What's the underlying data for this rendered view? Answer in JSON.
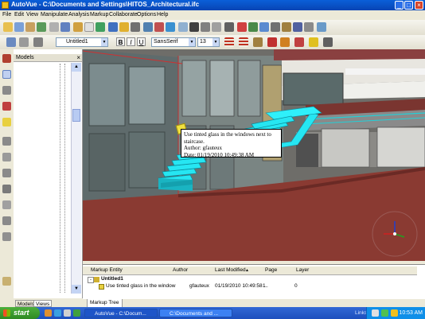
{
  "window": {
    "title": "AutoVue - C:\\Documents and Settings\\HITOS_Architectural.ifc"
  },
  "menu": [
    "File",
    "Edit",
    "View",
    "Manipulate",
    "Analysis",
    "Markup",
    "Collaborate",
    "Options",
    "Help"
  ],
  "toolbar": {
    "markup_name": "Untitled1",
    "bold_label": "B",
    "italic_label": "I",
    "underline_label": "U",
    "font_name": "SansSerif",
    "font_size": "13"
  },
  "models_panel": {
    "title": "Models",
    "tabs": [
      "Models",
      "Views"
    ]
  },
  "note": {
    "text": "Use tinted glass in the windows next to staircase.",
    "author": "Author: gfauteux",
    "date": "Date: 01/19/2010 10:49:38 AM"
  },
  "markup_table": {
    "headers": [
      "Markup Entity",
      "Author",
      "Last Modified",
      "Page",
      "Layer"
    ],
    "group_label": "Untitled1",
    "row": {
      "entity": "Use tinted glass in the window",
      "author": "gfauteux",
      "modified": "01/19/2010 10:49:58 ...",
      "page": "1",
      "layer": "0"
    },
    "tab": "Markup Tree"
  },
  "taskbar": {
    "start": "start",
    "tasks": [
      "AutoVue - C:\\Docum...",
      "C:\\Documents and ..."
    ],
    "links": "Links",
    "clock": "10:53 AM"
  },
  "colors": {
    "titlebar": "#0a5fd8",
    "stairs": "#26e6f2",
    "floor": "#8a3a32",
    "note_bg": "#ffffff",
    "taskbar": "#245edb"
  }
}
